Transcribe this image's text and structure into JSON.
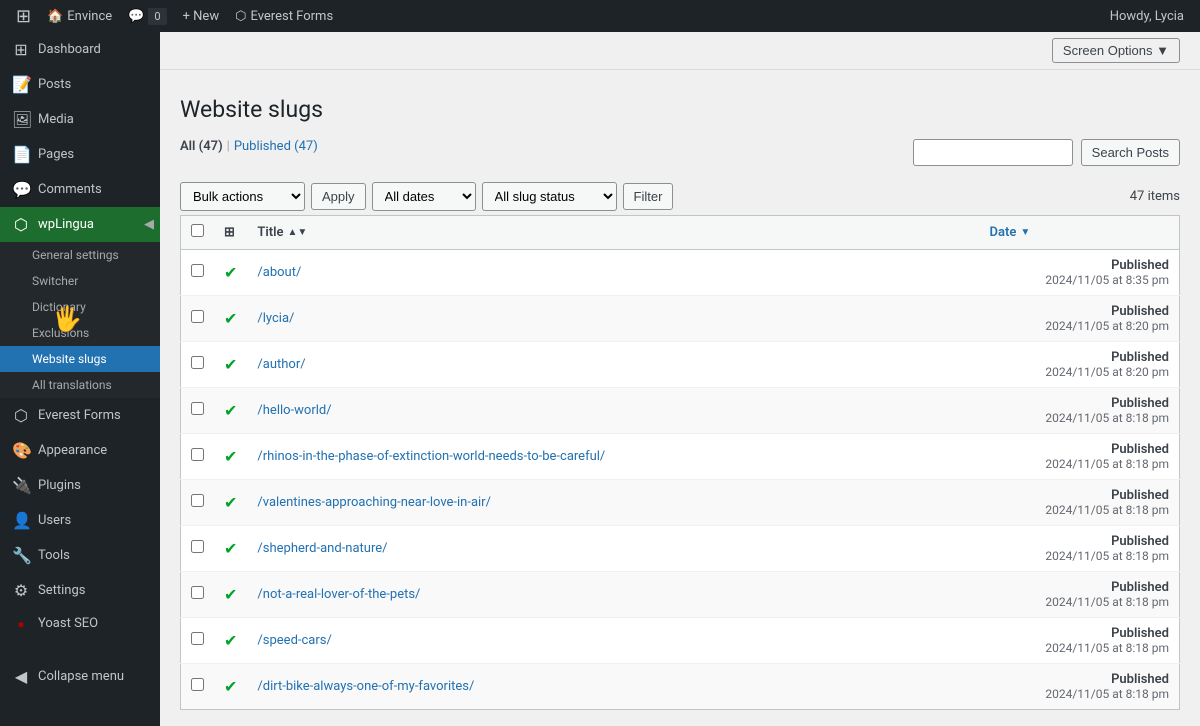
{
  "adminbar": {
    "logo": "W",
    "site_name": "Envince",
    "comments_icon": "💬",
    "comments_count": "0",
    "new_label": "+ New",
    "plugin_icon": "⬡",
    "plugin_name": "Everest Forms",
    "howdy": "Howdy, Lycia",
    "screen_options_label": "Screen Options ▼"
  },
  "sidebar": {
    "menu_items": [
      {
        "id": "dashboard",
        "icon": "⊞",
        "label": "Dashboard"
      },
      {
        "id": "posts",
        "icon": "📝",
        "label": "Posts"
      },
      {
        "id": "media",
        "icon": "🖼",
        "label": "Media"
      },
      {
        "id": "pages",
        "icon": "📄",
        "label": "Pages"
      },
      {
        "id": "comments",
        "icon": "💬",
        "label": "Comments"
      }
    ],
    "wplingua": {
      "label": "wpLingua",
      "icon": "⬡"
    },
    "wplingua_submenu": [
      {
        "id": "general-settings",
        "label": "General settings"
      },
      {
        "id": "switcher",
        "label": "Switcher"
      },
      {
        "id": "dictionary",
        "label": "Dictionary"
      },
      {
        "id": "exclusions",
        "label": "Exclusions"
      },
      {
        "id": "website-slugs",
        "label": "Website slugs",
        "active": true
      },
      {
        "id": "all-translations",
        "label": "All translations"
      }
    ],
    "bottom_items": [
      {
        "id": "everest-forms",
        "icon": "⬡",
        "label": "Everest Forms"
      },
      {
        "id": "appearance",
        "icon": "🎨",
        "label": "Appearance"
      },
      {
        "id": "plugins",
        "icon": "🔌",
        "label": "Plugins"
      },
      {
        "id": "users",
        "icon": "👤",
        "label": "Users"
      },
      {
        "id": "tools",
        "icon": "🔧",
        "label": "Tools"
      },
      {
        "id": "settings",
        "icon": "⚙",
        "label": "Settings"
      },
      {
        "id": "yoast-seo",
        "icon": "●",
        "label": "Yoast SEO"
      },
      {
        "id": "collapse-menu",
        "icon": "◀",
        "label": "Collapse menu"
      }
    ]
  },
  "page": {
    "title": "Website slugs",
    "filter_tabs": [
      {
        "id": "all",
        "label": "All",
        "count": "47",
        "active": true
      },
      {
        "id": "published",
        "label": "Published",
        "count": "47",
        "active": false
      }
    ],
    "search": {
      "placeholder": "",
      "button_label": "Search Posts"
    },
    "toolbar": {
      "bulk_actions_label": "Bulk actions",
      "apply_label": "Apply",
      "all_dates_label": "All dates",
      "all_slug_status_label": "All slug status",
      "filter_label": "Filter",
      "items_count": "47 items"
    },
    "table": {
      "columns": [
        {
          "id": "cb",
          "label": ""
        },
        {
          "id": "type",
          "label": ""
        },
        {
          "id": "title",
          "label": "Title",
          "sortable": true,
          "sort_dir": "asc"
        },
        {
          "id": "date",
          "label": "Date",
          "sortable": true,
          "sort_dir": "desc",
          "sorted": true
        }
      ],
      "rows": [
        {
          "slug": "/about/",
          "status": "Published",
          "date": "2024/11/05 at 8:35 pm"
        },
        {
          "slug": "/lycia/",
          "status": "Published",
          "date": "2024/11/05 at 8:20 pm"
        },
        {
          "slug": "/author/",
          "status": "Published",
          "date": "2024/11/05 at 8:20 pm"
        },
        {
          "slug": "/hello-world/",
          "status": "Published",
          "date": "2024/11/05 at 8:18 pm"
        },
        {
          "slug": "/rhinos-in-the-phase-of-extinction-world-needs-to-be-careful/",
          "status": "Published",
          "date": "2024/11/05 at 8:18 pm"
        },
        {
          "slug": "/valentines-approaching-near-love-in-air/",
          "status": "Published",
          "date": "2024/11/05 at 8:18 pm"
        },
        {
          "slug": "/shepherd-and-nature/",
          "status": "Published",
          "date": "2024/11/05 at 8:18 pm"
        },
        {
          "slug": "/not-a-real-lover-of-the-pets/",
          "status": "Published",
          "date": "2024/11/05 at 8:18 pm"
        },
        {
          "slug": "/speed-cars/",
          "status": "Published",
          "date": "2024/11/05 at 8:18 pm"
        },
        {
          "slug": "/dirt-bike-always-one-of-my-favorites/",
          "status": "Published",
          "date": "2024/11/05 at 8:18 pm"
        }
      ]
    }
  }
}
